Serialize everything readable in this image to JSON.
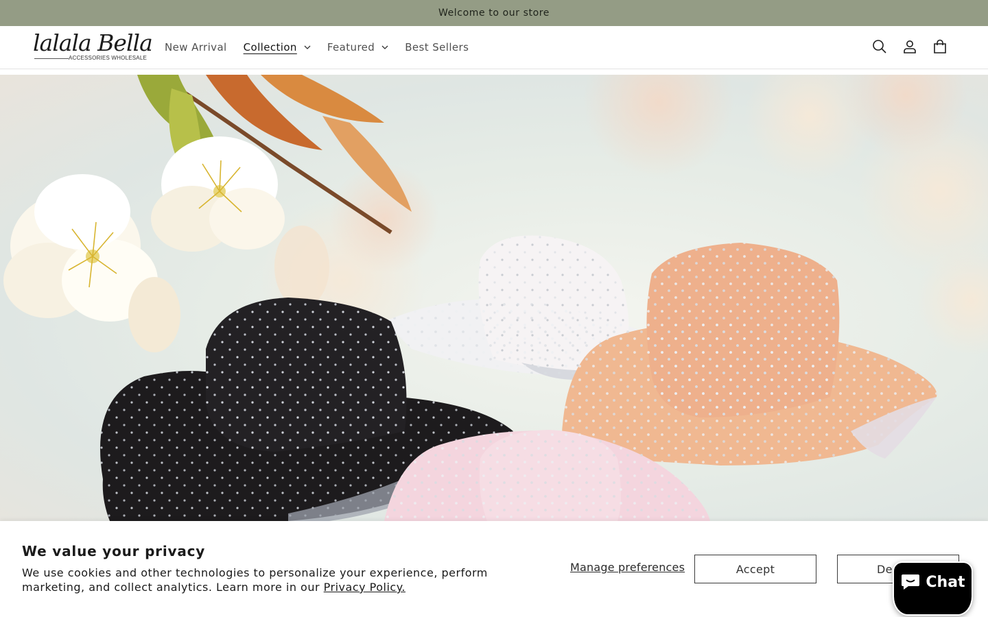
{
  "announcement": {
    "text": "Welcome to our store"
  },
  "logo": {
    "script": "lalala Bella",
    "subtitle": "ACCESSORIES WHOLESALE"
  },
  "nav": {
    "items": [
      {
        "label": "New Arrival",
        "has_dropdown": false
      },
      {
        "label": "Collection",
        "has_dropdown": true,
        "active": true
      },
      {
        "label": "Featured",
        "has_dropdown": true
      },
      {
        "label": "Best Sellers",
        "has_dropdown": false
      }
    ]
  },
  "header_icons": [
    "search-icon",
    "account-icon",
    "cart-icon"
  ],
  "cookie_banner": {
    "title": "We value your privacy",
    "body": "We use cookies and other technologies to personalize your experience, perform marketing, and collect analytics. Learn more in our ",
    "link_label": "Privacy Policy.",
    "manage_label": "Manage preferences",
    "accept_label": "Accept",
    "decline_label": "Decline"
  },
  "chat": {
    "label": "Chat"
  },
  "colors": {
    "announcement_bg": "#949c85",
    "chat_bg": "#000000"
  }
}
